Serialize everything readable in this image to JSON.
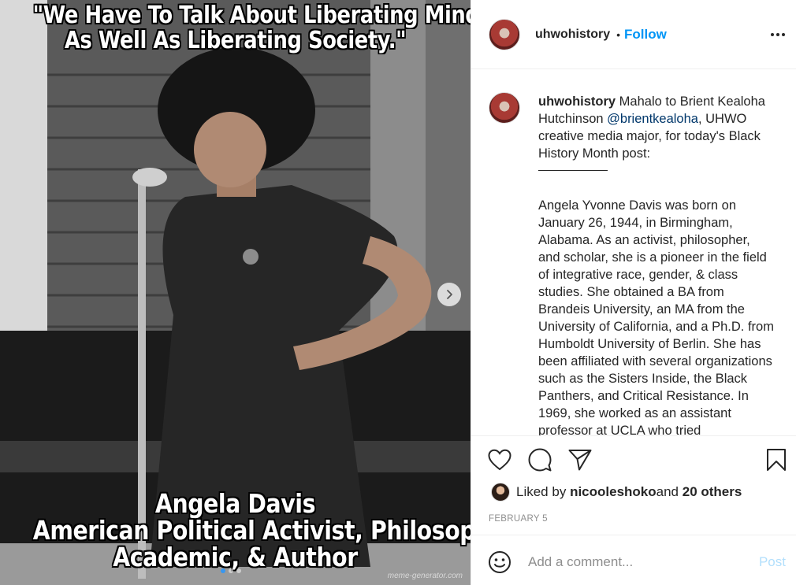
{
  "media": {
    "quote_line1": "\"We Have To Talk About Liberating Minds",
    "quote_line2": "As Well As Liberating Society.\"",
    "caption_line1": "Angela Davis",
    "caption_line2": "American Political Activist, Philosopher,",
    "caption_line3": "Academic, & Author",
    "watermark": "meme-generator.com",
    "next_icon": "chevron-right-icon",
    "carousel_active_index": 0,
    "carousel_count": 3
  },
  "header": {
    "username": "uhwohistory",
    "separator": "•",
    "follow_label": "Follow",
    "more_icon": "more-horizontal-icon"
  },
  "caption": {
    "username": "uhwohistory",
    "intro_text": " Mahalo to Brient Kealoha Hutchinson ",
    "mention": "@brientkealoha",
    "intro_text_after": ", UHWO creative media major, for today's Black History Month post:",
    "body": "Angela Yvonne Davis was born on January 26, 1944, in Birmingham, Alabama.  As an activist, philosopher, and scholar, she is a pioneer in the field of integrative race, gender, & class studies. She obtained a BA from Brandeis University, an MA from the University of California, and a Ph.D. from Humboldt University of Berlin. She has been affiliated with several organizations such as the Sisters Inside, the Black Panthers, and Critical Resistance. In 1969, she worked as an assistant professor at UCLA who tried"
  },
  "actions": {
    "like_icon": "heart-icon",
    "comment_icon": "comment-bubble-icon",
    "share_icon": "paper-plane-icon",
    "save_icon": "bookmark-icon"
  },
  "likes": {
    "prefix": "Liked by ",
    "user": "nicooleshoko",
    "middle": " and ",
    "others": "20 others"
  },
  "date": "FEBRUARY 5",
  "comment_box": {
    "emoji_icon": "smiley-face-icon",
    "placeholder": "Add a comment...",
    "post_label": "Post"
  },
  "colors": {
    "link_blue": "#0095f6",
    "mention_blue": "#00376b",
    "post_disabled": "#b2dffc",
    "muted_gray": "#8e8e8e",
    "text": "#262626"
  }
}
